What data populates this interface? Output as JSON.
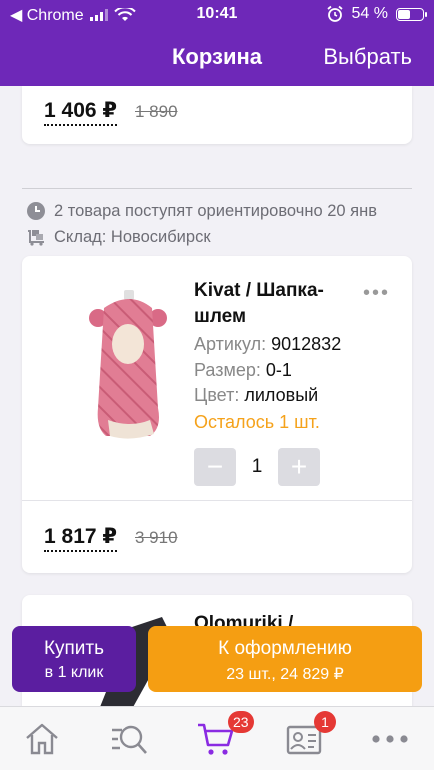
{
  "status_bar": {
    "back_app": "◀ Chrome",
    "time": "10:41",
    "battery": "54 %",
    "battery_level": 0.54
  },
  "nav": {
    "title": "Корзина",
    "action": "Выбрать"
  },
  "top_item": {
    "price": "1 406 ₽",
    "old_price": "1 890"
  },
  "delivery": {
    "eta": "2 товара поступят ориентировочно 20 янв",
    "warehouse": "Склад: Новосибирск"
  },
  "item": {
    "title": "Kivat / Шапка-шлем",
    "article_label": "Артикул:",
    "article": "9012832",
    "size_label": "Размер:",
    "size": "0-1",
    "color_label": "Цвет:",
    "color": "лиловый",
    "stock": "Осталось 1 шт.",
    "minus": "−",
    "quantity": "1",
    "plus": "+",
    "more": "•••",
    "price": "1 817 ₽",
    "old_price": "3 910"
  },
  "next_item": {
    "title": "Olomuriki /"
  },
  "buttons": {
    "quick_buy_line1": "Купить",
    "quick_buy_line2": "в 1 клик",
    "checkout_line1": "К оформлению",
    "checkout_line2": "23 шт., 24 829 ₽"
  },
  "tabbar": {
    "cart_badge": "23",
    "profile_badge": "1"
  },
  "colors": {
    "header": "#6e28b8",
    "quick_buy": "#5b1ea0",
    "checkout": "#f59e12",
    "stock_warning": "#f5a21b",
    "badge": "#e53935",
    "cart_active": "#8a2be2"
  }
}
